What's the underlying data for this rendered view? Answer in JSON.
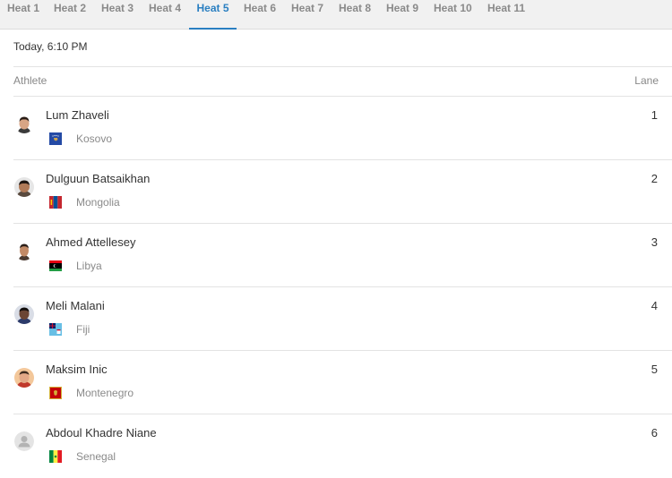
{
  "tabs": [
    {
      "label": "Heat 1"
    },
    {
      "label": "Heat 2"
    },
    {
      "label": "Heat 3"
    },
    {
      "label": "Heat 4"
    },
    {
      "label": "Heat 5"
    },
    {
      "label": "Heat 6"
    },
    {
      "label": "Heat 7"
    },
    {
      "label": "Heat 8"
    },
    {
      "label": "Heat 9"
    },
    {
      "label": "Heat 10"
    },
    {
      "label": "Heat 11"
    }
  ],
  "active_tab": "Heat 5",
  "datetime": "Today, 6:10 PM",
  "columns": {
    "athlete": "Athlete",
    "lane": "Lane"
  },
  "colors": {
    "accent": "#2a7fc1",
    "tab_bg": "#f1f1f1"
  },
  "athletes": [
    {
      "name": "Lum Zhaveli",
      "country": "Kosovo",
      "lane": "1",
      "flag_icon": "kosovo-flag-icon"
    },
    {
      "name": "Dulguun Batsaikhan",
      "country": "Mongolia",
      "lane": "2",
      "flag_icon": "mongolia-flag-icon"
    },
    {
      "name": "Ahmed Attellesey",
      "country": "Libya",
      "lane": "3",
      "flag_icon": "libya-flag-icon"
    },
    {
      "name": "Meli Malani",
      "country": "Fiji",
      "lane": "4",
      "flag_icon": "fiji-flag-icon"
    },
    {
      "name": "Maksim Inic",
      "country": "Montenegro",
      "lane": "5",
      "flag_icon": "montenegro-flag-icon"
    },
    {
      "name": "Abdoul Khadre Niane",
      "country": "Senegal",
      "lane": "6",
      "flag_icon": "senegal-flag-icon"
    }
  ]
}
